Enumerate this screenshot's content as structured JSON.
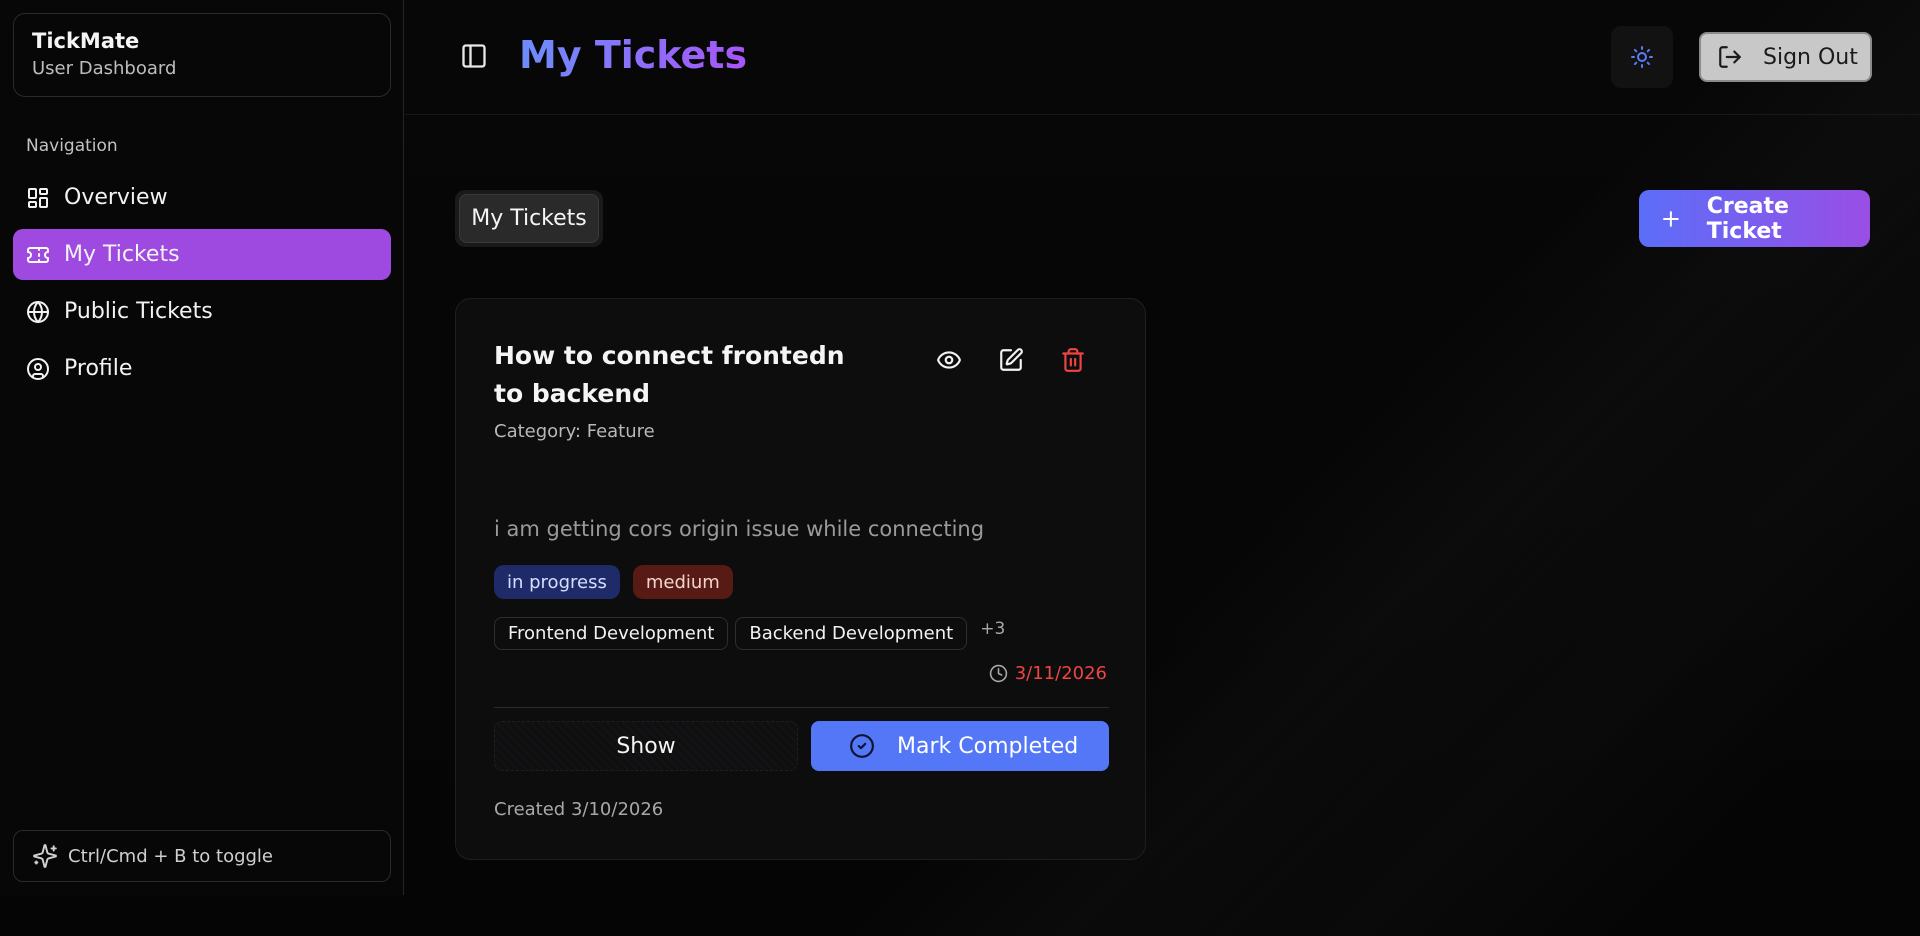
{
  "sidebar": {
    "brand_title": "TickMate",
    "brand_subtitle": "User Dashboard",
    "nav_heading": "Navigation",
    "items": [
      {
        "label": "Overview",
        "icon": "dashboard-icon",
        "active": false
      },
      {
        "label": "My Tickets",
        "icon": "ticket-icon",
        "active": true
      },
      {
        "label": "Public Tickets",
        "icon": "globe-icon",
        "active": false
      },
      {
        "label": "Profile",
        "icon": "user-circle-icon",
        "active": false
      }
    ],
    "toggle_hint": "Ctrl/Cmd + B to toggle",
    "active_color": "#9e4ae0"
  },
  "header": {
    "title": "My Tickets",
    "theme_icon": "sun-icon",
    "sign_out_label": "Sign Out"
  },
  "main": {
    "tab_label": "My Tickets",
    "create_label": "Create Ticket",
    "tickets": [
      {
        "title": "How to connect frontedn to backend",
        "category": "Category: Feature",
        "description": "i am getting cors origin issue while connecting",
        "status": "in progress",
        "priority": "medium",
        "tags": [
          "Frontend Development",
          "Backend Development"
        ],
        "more_tags": "+3",
        "due_date": "3/11/2026",
        "show_label": "Show",
        "complete_label": "Mark Completed",
        "created": "Created 3/10/2026"
      }
    ]
  },
  "colors": {
    "accent_blue": "#5377f7",
    "accent_purple": "#a855f7",
    "danger": "#ef4444"
  }
}
